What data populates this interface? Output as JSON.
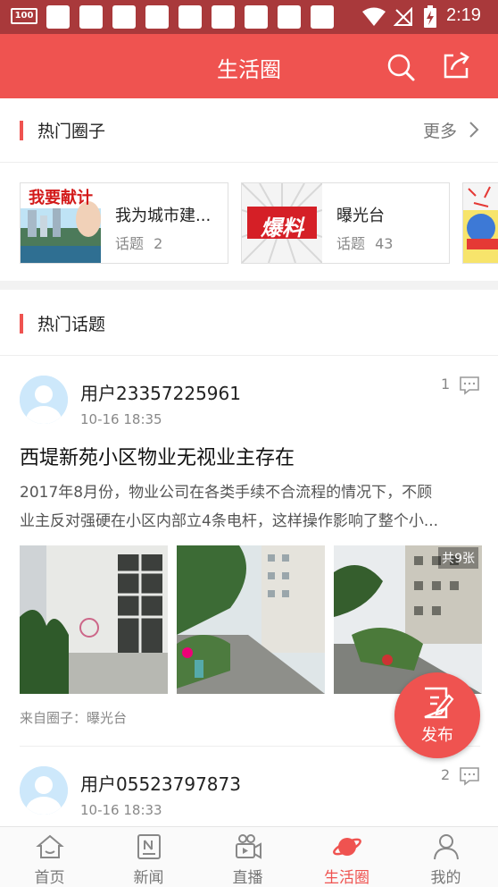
{
  "status_bar": {
    "battery": "100",
    "time": "2:19"
  },
  "header": {
    "title": "生活圈"
  },
  "hot_circles": {
    "title": "热门圈子",
    "more": "更多",
    "items": [
      {
        "name": "我为城市建...",
        "topic_label": "话题",
        "topic_count": "2",
        "thumb_text": "我要献计"
      },
      {
        "name": "曝光台",
        "topic_label": "话题",
        "topic_count": "43",
        "thumb_text": "爆料"
      }
    ]
  },
  "hot_topics": {
    "title": "热门话题"
  },
  "posts": [
    {
      "user": "用户23357225961",
      "time": "10-16 18:35",
      "comments": "1",
      "title": "西堤新苑小区物业无视业主存在",
      "excerpt_line1": "2017年8月份，物业公司在各类手续不合流程的情况下，不顾",
      "excerpt_line2": "业主反对强硬在小区内部立4条电杆，这样操作影响了整个小...",
      "photo_count": "共9张",
      "source": "来自圈子：曝光台"
    },
    {
      "user": "用户05523797873",
      "time": "10-16 18:33",
      "comments": "2"
    }
  ],
  "fab": {
    "label": "发布"
  },
  "bottom_nav": [
    {
      "label": "首页",
      "icon": "home-icon"
    },
    {
      "label": "新闻",
      "icon": "news-icon"
    },
    {
      "label": "直播",
      "icon": "live-icon"
    },
    {
      "label": "生活圈",
      "icon": "planet-icon",
      "active": true
    },
    {
      "label": "我的",
      "icon": "profile-icon"
    }
  ],
  "colors": {
    "accent": "#ef5350",
    "status_bar": "#a9393b"
  }
}
